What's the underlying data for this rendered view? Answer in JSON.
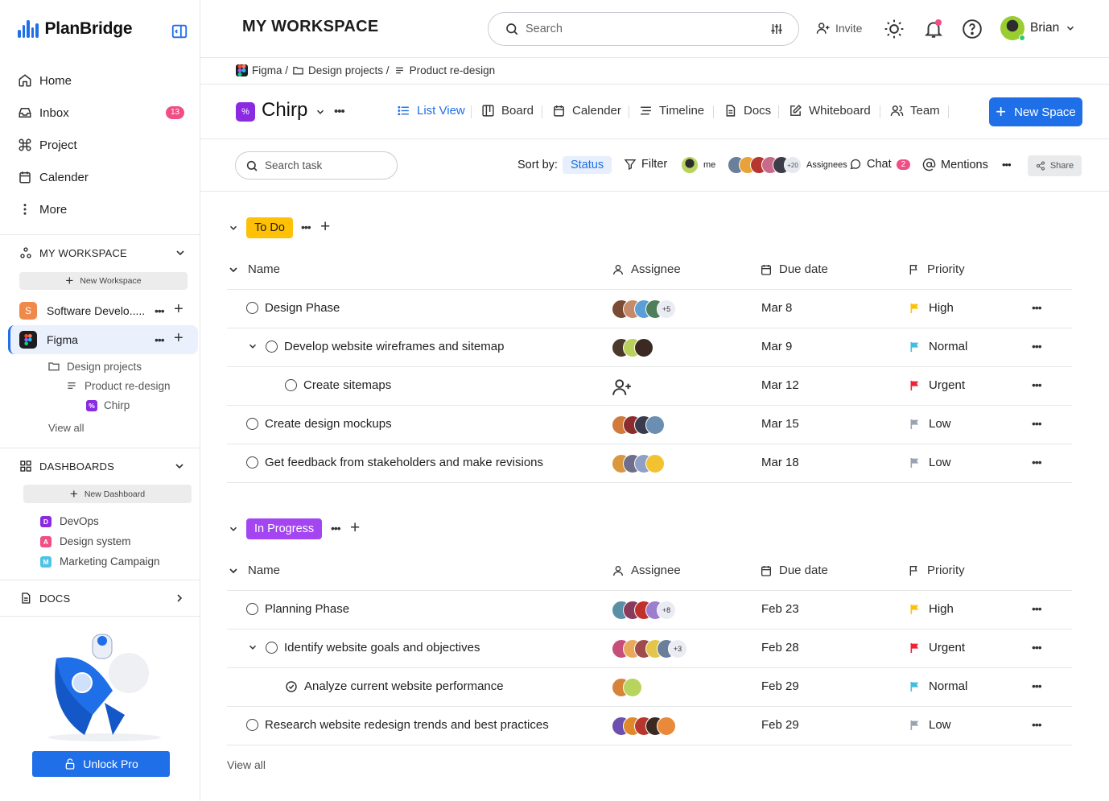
{
  "colors": {
    "accent": "#1f6fe8",
    "badge": "#f04e85",
    "todo": "#ffc107",
    "inprogress": "#a445f2",
    "high": "#ffc107",
    "normal": "#3fbfe0",
    "urgent": "#ef2335",
    "low": "#9aa3b3"
  },
  "sidebar": {
    "brand": "PlanBridge",
    "nav": [
      {
        "label": "Home",
        "icon": "home-icon"
      },
      {
        "label": "Inbox",
        "icon": "inbox-icon",
        "badge": "13"
      },
      {
        "label": "Project",
        "icon": "command-icon"
      },
      {
        "label": "Calender",
        "icon": "calendar-icon"
      },
      {
        "label": "More",
        "icon": "more-vertical-icon"
      }
    ],
    "workspace_header": "MY WORKSPACE",
    "new_workspace": "New Workspace",
    "workspaces": [
      {
        "label": "Software Develo.....",
        "initial": "S"
      },
      {
        "label": "Figma"
      }
    ],
    "tree": {
      "folder": "Design projects",
      "list": "Product re-design",
      "space": "Chirp",
      "view_all": "View all"
    },
    "dashboards_header": "DASHBOARDS",
    "new_dashboard": "New Dashboard",
    "dashboards": [
      {
        "label": "DevOps",
        "initial": "D",
        "color": "#8a2be2"
      },
      {
        "label": "Design system",
        "initial": "A",
        "color": "#f04e85"
      },
      {
        "label": "Marketing Campaign",
        "initial": "M",
        "color": "#4fc3e8"
      }
    ],
    "docs_header": "DOCS",
    "unlock": "Unlock Pro"
  },
  "header": {
    "title": "MY WORKSPACE",
    "search_placeholder": "Search",
    "invite": "Invite",
    "user": "Brian"
  },
  "breadcrumb": {
    "root": "Figma /",
    "folder": "Design projects /",
    "list": "Product re-design"
  },
  "space": {
    "name": "Chirp",
    "tabs": [
      {
        "label": "List View",
        "icon": "list-icon",
        "active": true
      },
      {
        "label": "Board",
        "icon": "board-icon"
      },
      {
        "label": "Calender",
        "icon": "calendar-icon"
      },
      {
        "label": "Timeline",
        "icon": "timeline-icon"
      },
      {
        "label": "Docs",
        "icon": "doc-icon"
      },
      {
        "label": "Whiteboard",
        "icon": "whiteboard-icon"
      },
      {
        "label": "Team",
        "icon": "team-icon"
      }
    ],
    "new_space": "New Space"
  },
  "toolbar": {
    "search_placeholder": "Search task",
    "sort_by": "Sort by:",
    "sort_value": "Status",
    "filter": "Filter",
    "me": "me",
    "assignees_more": "+20",
    "assignees": "Assignees",
    "chat": "Chat",
    "chat_count": "2",
    "mentions": "Mentions",
    "share": "Share"
  },
  "columns": {
    "name": "Name",
    "assignee": "Assignee",
    "due": "Due date",
    "priority": "Priority"
  },
  "groups": [
    {
      "label": "To Do",
      "tasks": [
        {
          "name": "Design Phase",
          "due": "Mar 8",
          "priority": "High",
          "more": "+5",
          "avatars": [
            "#7a4b34",
            "#c58a6a",
            "#5aa0d6",
            "#4f7f5a"
          ]
        },
        {
          "name": "Develop website wireframes and sitemap",
          "due": "Mar 9",
          "priority": "Normal",
          "expand": true,
          "avatars": [
            "#4a3a2c",
            "#b9d15a",
            "#3c2a22"
          ]
        },
        {
          "name": "Create sitemaps",
          "due": "Mar 12",
          "priority": "Urgent",
          "child": true,
          "avatars": []
        },
        {
          "name": "Create design mockups",
          "due": "Mar 15",
          "priority": "Low",
          "avatars": [
            "#d07a3c",
            "#8b2d2d",
            "#3b3b4f",
            "#6a8fb3"
          ]
        },
        {
          "name": "Get feedback from stakeholders and make revisions",
          "due": "Mar 18",
          "priority": "Low",
          "avatars": [
            "#d9973f",
            "#6e6e8a",
            "#8f9fc6",
            "#f2c230"
          ]
        }
      ]
    },
    {
      "label": "In Progress",
      "tasks": [
        {
          "name": "Planning Phase",
          "due": "Feb 23",
          "priority": "High",
          "more": "+8",
          "avatars": [
            "#5a8fa6",
            "#8a3a5c",
            "#c0312b",
            "#9c7ecf"
          ]
        },
        {
          "name": "Identify website goals and objectives",
          "due": "Feb 28",
          "priority": "Urgent",
          "expand": true,
          "more": "+3",
          "avatars": [
            "#c84e7a",
            "#e8a95a",
            "#a04b4b",
            "#e3c54a",
            "#6a7f9a"
          ]
        },
        {
          "name": "Analyze current website performance",
          "due": "Feb 29",
          "priority": "Normal",
          "child": true,
          "done": true,
          "avatars": [
            "#d6843a",
            "#b8d35e"
          ]
        },
        {
          "name": "Research website redesign trends and best practices",
          "due": "Feb 29",
          "priority": "Low",
          "avatars": [
            "#6d4fb0",
            "#e0892c",
            "#b5372e",
            "#3a2a22",
            "#e98a3a"
          ]
        }
      ]
    }
  ],
  "view_all": "View all"
}
